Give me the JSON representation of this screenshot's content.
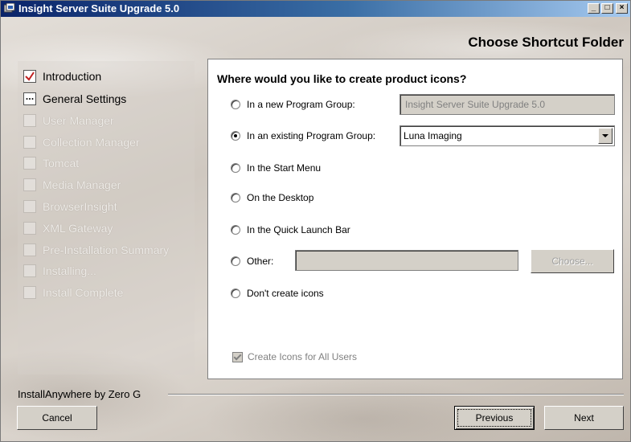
{
  "window": {
    "title": "Insight Server Suite Upgrade 5.0",
    "minimize_glyph": "_",
    "maximize_glyph": "□",
    "close_glyph": "×"
  },
  "panel": {
    "title": "Choose Shortcut Folder"
  },
  "steps": [
    {
      "label": "Introduction",
      "state": "done"
    },
    {
      "label": "General Settings",
      "state": "current"
    },
    {
      "label": "User Manager",
      "state": "pending"
    },
    {
      "label": "Collection Manager",
      "state": "pending"
    },
    {
      "label": "Tomcat",
      "state": "pending"
    },
    {
      "label": "Media Manager",
      "state": "pending"
    },
    {
      "label": "BrowserInsight",
      "state": "pending"
    },
    {
      "label": "XML Gateway",
      "state": "pending"
    },
    {
      "label": "Pre-Installation Summary",
      "state": "pending"
    },
    {
      "label": "Installing...",
      "state": "pending"
    },
    {
      "label": "Install Complete",
      "state": "pending"
    }
  ],
  "form": {
    "question": "Where would you like to create product icons?",
    "options": {
      "new_group": "In a new Program Group:",
      "existing_group": "In an existing Program Group:",
      "start_menu": "In the Start Menu",
      "desktop": "On the Desktop",
      "quick_launch": "In the Quick Launch Bar",
      "other": "Other:",
      "none": "Don't create icons"
    },
    "selected_option": "existing_group",
    "new_group_value": "Insight Server Suite Upgrade 5.0",
    "existing_group_value": "Luna Imaging",
    "other_value": "",
    "choose_label": "Choose...",
    "all_users_label": "Create Icons for All Users",
    "all_users_checked": true
  },
  "footer": {
    "brand": "InstallAnywhere by Zero G",
    "cancel_label": "Cancel",
    "previous_label": "Previous",
    "next_label": "Next"
  }
}
